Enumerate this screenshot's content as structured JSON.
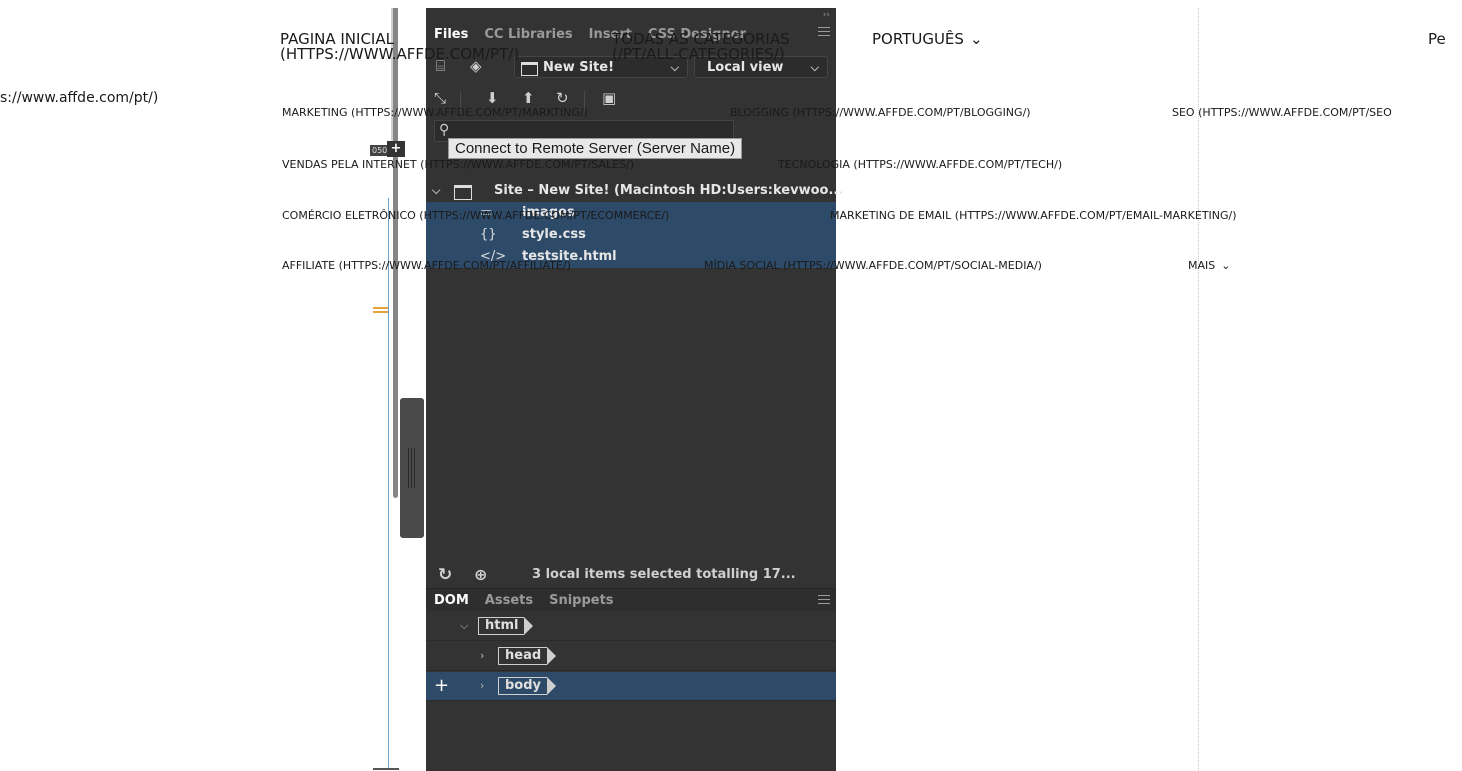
{
  "page": {
    "url_fragment": "s://www.affde.com/pt/)",
    "nav": {
      "home": "PAGINA INICIAL (HTTPS://WWW.AFFDE.COM/PT/)",
      "all_categories": "TODAS AS CATEGORIAS (/PT/ALL-CATEGORIES/)",
      "language": "PORTUGUÊS",
      "more_cut": "Pe"
    },
    "categories": {
      "row1": [
        "MARKETING (HTTPS://WWW.AFFDE.COM/PT/MARKTING/)",
        "BLOGGING (HTTPS://WWW.AFFDE.COM/PT/BLOGGING/)",
        "SEO (HTTPS://WWW.AFFDE.COM/PT/SEO"
      ],
      "row2": [
        "VENDAS PELA INTERNET (HTTPS://WWW.AFFDE.COM/PT/SALES/)",
        "TECNOLOGIA (HTTPS://WWW.AFFDE.COM/PT/TECH/)"
      ],
      "row3": [
        "COMÉRCIO ELETRÔNICO (HTTPS://WWW.AFFDE.COM/PT/ECOMMERCE/)",
        "MARKETING DE EMAIL (HTTPS://WWW.AFFDE.COM/PT/EMAIL-MARKETING/)"
      ],
      "row4": [
        "AFFILIATE (HTTPS://WWW.AFFDE.COM/PT/AFFILIATE/)",
        "MÍDIA SOCIAL (HTTPS://WWW.AFFDE.COM/PT/SOCIAL-MEDIA/)",
        "MAIS"
      ]
    }
  },
  "dreamweaver": {
    "ruler_number": "050",
    "tabs": [
      "Files",
      "CC Libraries",
      "Insert",
      "CSS Designer"
    ],
    "site_select": "New Site!",
    "view_select": "Local view",
    "tooltip": "Connect to Remote Server (Server Name)",
    "site_root": "Site – New Site! (Macintosh HD:Users:kevwoo...",
    "files": [
      {
        "icon": "▭",
        "name": "images"
      },
      {
        "icon": "{}",
        "name": "style.css"
      },
      {
        "icon": "</>",
        "name": "testsite.html"
      }
    ],
    "status": "3 local items selected totalling 17...",
    "bottom_tabs": [
      "DOM",
      "Assets",
      "Snippets"
    ],
    "dom_tags": [
      "html",
      "head",
      "body"
    ]
  },
  "colors": {
    "panel_bg": "#333333",
    "selection": "#2d4a68",
    "accent_orange": "#e3a23b"
  }
}
